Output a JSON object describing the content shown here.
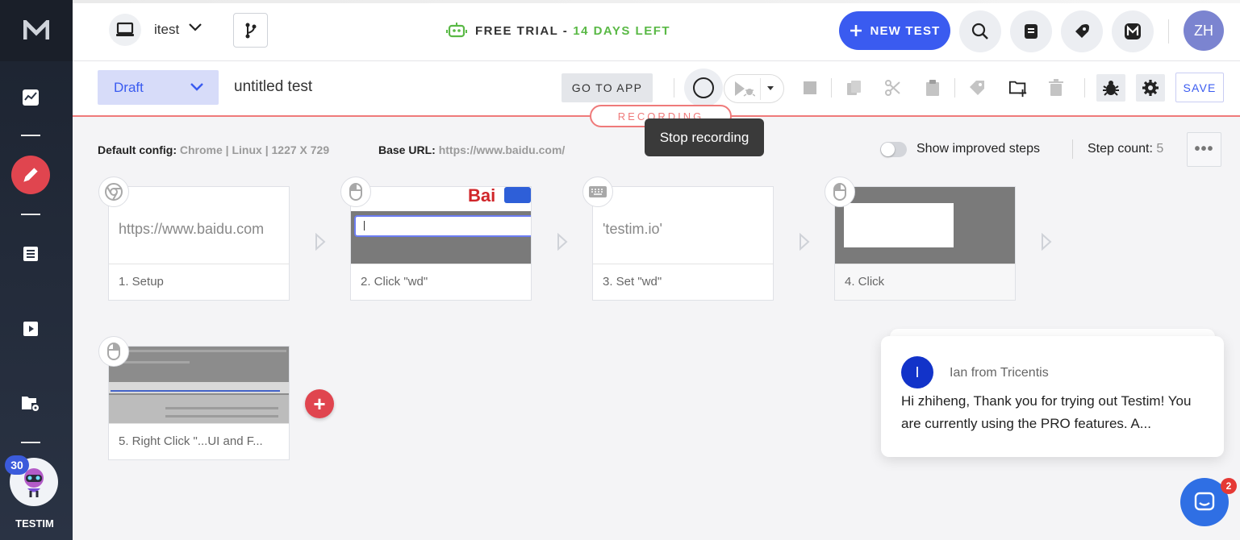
{
  "brand": {
    "logo": "M",
    "label": "TESTIM",
    "avatar_badge": "30"
  },
  "header": {
    "device_label": "itest",
    "trial_prefix": "FREE TRIAL -",
    "trial_days": "14 DAYS LEFT",
    "new_test_label": "NEW TEST",
    "user_initials": "ZH"
  },
  "toolbar": {
    "status": "Draft",
    "test_name": "untitled test",
    "goto_app": "GO TO APP",
    "save": "SAVE",
    "recording": "RECORDING",
    "tooltip": "Stop recording"
  },
  "info": {
    "default_config_label": "Default config:",
    "default_config_value": "Chrome | Linux | 1227 X 729",
    "base_url_label": "Base URL:",
    "base_url_value": "https://www.baidu.com/",
    "improved_steps": "Show improved steps",
    "step_count_label": "Step count:",
    "step_count": "5",
    "more": "•••"
  },
  "steps": [
    {
      "caption": "1. Setup",
      "thumb_text": "https://www.baidu.com",
      "icon": "chrome-icon"
    },
    {
      "caption": "2. Click \"wd\"",
      "icon": "mouse-icon"
    },
    {
      "caption": "3. Set \"wd\"",
      "thumb_text": "'testim.io'",
      "icon": "keyboard-icon"
    },
    {
      "caption": "4. Click",
      "icon": "mouse-icon"
    },
    {
      "caption": "5. Right Click \"...UI and F...",
      "icon": "mouse-right-icon"
    }
  ],
  "chat": {
    "avatar": "I",
    "from": "Ian from Tricentis",
    "message": "Hi zhiheng, Thank you for trying out Testim! You are currently using the PRO features. A...",
    "badge": "2"
  },
  "colors": {
    "accent": "#3a5bf0",
    "record": "#e0454f",
    "trial_green": "#5ab946"
  }
}
